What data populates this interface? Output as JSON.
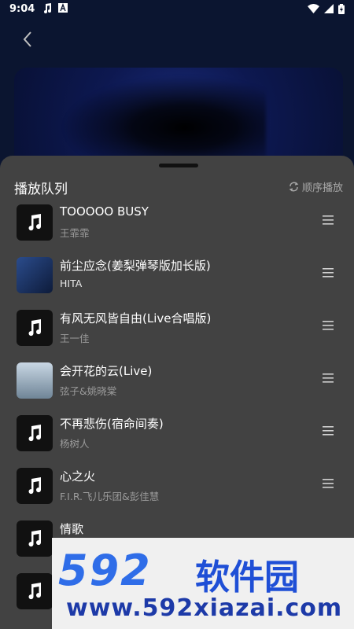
{
  "status": {
    "time": "9:04"
  },
  "queue": {
    "title": "播放队列",
    "order_label": "顺序播放"
  },
  "items": [
    {
      "title": "TOOOOO BUSY",
      "artist": "王霏霏",
      "thumb": "note"
    },
    {
      "title": "前尘应念(姜梨弹琴版加长版)",
      "artist": "HITA",
      "thumb": "art1"
    },
    {
      "title": "有风无风皆自由(Live合唱版)",
      "artist": "王一佳",
      "thumb": "note"
    },
    {
      "title": "会开花的云(Live)",
      "artist": "弦子&姚晓棠",
      "thumb": "art2"
    },
    {
      "title": "不再悲伤(宿命间奏)",
      "artist": "杨树人",
      "thumb": "note"
    },
    {
      "title": "心之火",
      "artist": "F.I.R.飞儿乐团&彭佳慧",
      "thumb": "note"
    },
    {
      "title": "情歌",
      "artist": "",
      "thumb": "note"
    },
    {
      "title": "",
      "artist": "",
      "thumb": "note"
    }
  ],
  "watermark": {
    "logo": "592",
    "name": "软件园",
    "url": "www.592xiazai.com"
  },
  "colors": {
    "sheet": "#424242",
    "secondary_text": "#9b9b9b",
    "watermark_blue": "#2f6de8"
  }
}
